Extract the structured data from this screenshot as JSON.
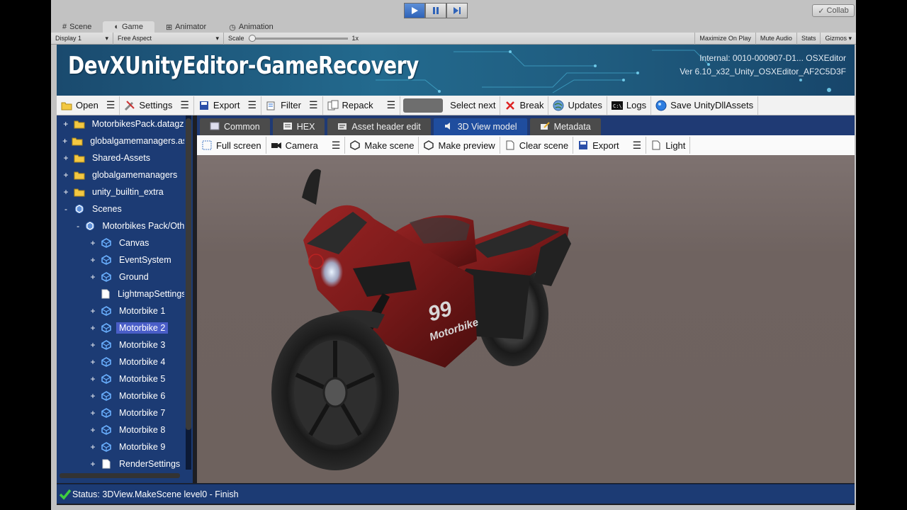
{
  "play_controls": {
    "play_icon": "play-icon",
    "pause_icon": "pause-icon",
    "step_icon": "step-icon"
  },
  "collab": {
    "label": "Collab"
  },
  "editor_tabs": [
    {
      "label": "Scene",
      "icon": "grid-icon"
    },
    {
      "label": "Game",
      "icon": "game-icon"
    },
    {
      "label": "Animator",
      "icon": "animator-icon"
    },
    {
      "label": "Animation",
      "icon": "clock-icon"
    }
  ],
  "game_bar": {
    "display": "Display 1",
    "aspect": "Free Aspect",
    "scale_label": "Scale",
    "scale_value": "1x",
    "maximize": "Maximize On Play",
    "mute": "Mute Audio",
    "stats": "Stats",
    "gizmos": "Gizmos"
  },
  "banner": {
    "title": "DevXUnityEditor-GameRecovery",
    "internal": "Internal: 0010-000907-D1... OSXEditor",
    "version": "Ver 6.10_x32_Unity_OSXEditor_AF2C5D3F"
  },
  "toolbar": {
    "open": "Open",
    "settings": "Settings",
    "export": "Export",
    "filter": "Filter",
    "repack": "Repack",
    "select_next": "Select next",
    "break": "Break",
    "updates": "Updates",
    "logs": "Logs",
    "save": "Save UnityDllAssets"
  },
  "tree": {
    "items": [
      {
        "label": "MotorbikesPack.datagz",
        "expander": "+",
        "icon": "folder-icon"
      },
      {
        "label": "globalgamemanagers.assets",
        "expander": "+",
        "icon": "folder-icon"
      },
      {
        "label": "Shared-Assets",
        "expander": "+",
        "icon": "folder-icon"
      },
      {
        "label": "globalgamemanagers",
        "expander": "+",
        "icon": "folder-icon"
      },
      {
        "label": "unity_builtin_extra",
        "expander": "+",
        "icon": "folder-icon"
      },
      {
        "label": "Scenes",
        "expander": "-",
        "icon": "unity-icon"
      },
      {
        "label": "Motorbikes Pack/Other",
        "expander": "-",
        "icon": "unity-icon"
      },
      {
        "label": "Canvas",
        "expander": "+",
        "icon": "gameobject-icon"
      },
      {
        "label": "EventSystem",
        "expander": "+",
        "icon": "gameobject-icon"
      },
      {
        "label": "Ground",
        "expander": "+",
        "icon": "gameobject-icon"
      },
      {
        "label": "LightmapSettings",
        "expander": "",
        "icon": "file-icon"
      },
      {
        "label": "Motorbike 1",
        "expander": "+",
        "icon": "gameobject-icon"
      },
      {
        "label": "Motorbike 2",
        "expander": "+",
        "icon": "gameobject-icon"
      },
      {
        "label": "Motorbike 3",
        "expander": "+",
        "icon": "gameobject-icon"
      },
      {
        "label": "Motorbike 4",
        "expander": "+",
        "icon": "gameobject-icon"
      },
      {
        "label": "Motorbike 5",
        "expander": "+",
        "icon": "gameobject-icon"
      },
      {
        "label": "Motorbike 6",
        "expander": "+",
        "icon": "gameobject-icon"
      },
      {
        "label": "Motorbike 7",
        "expander": "+",
        "icon": "gameobject-icon"
      },
      {
        "label": "Motorbike 8",
        "expander": "+",
        "icon": "gameobject-icon"
      },
      {
        "label": "Motorbike 9",
        "expander": "+",
        "icon": "gameobject-icon"
      },
      {
        "label": "RenderSettings",
        "expander": "+",
        "icon": "file-icon"
      }
    ]
  },
  "panel_tabs": [
    {
      "label": "Common",
      "icon": "common-icon"
    },
    {
      "label": "HEX",
      "icon": "hex-icon"
    },
    {
      "label": "Asset header edit",
      "icon": "header-icon"
    },
    {
      "label": "3D View model",
      "icon": "speaker-icon"
    },
    {
      "label": "Metadata",
      "icon": "edit-icon"
    }
  ],
  "view_toolbar": {
    "full_screen": "Full screen",
    "camera": "Camera",
    "make_scene": "Make scene",
    "make_preview": "Make preview",
    "clear_scene": "Clear scene",
    "export": "Export",
    "light": "Light"
  },
  "model": {
    "decal_number": "99",
    "decal_text": "Motorbike"
  },
  "status": {
    "text": "Status: 3DView.MakeScene level0 - Finish"
  }
}
